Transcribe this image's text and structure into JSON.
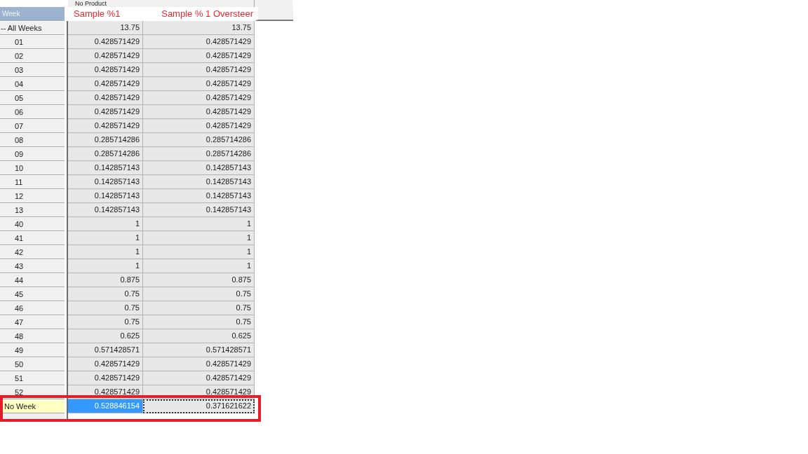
{
  "grid": {
    "product_header": "No Product",
    "row_header_title": "Week",
    "columns": [
      {
        "label": "Sample %1"
      },
      {
        "label": "Sample % 1 Oversteer"
      }
    ],
    "rows": [
      {
        "label": "-- All Weeks",
        "kind": "total",
        "selected": false,
        "outlined": false,
        "cells": [
          {
            "value": "13.75",
            "selected": false,
            "focused": false
          },
          {
            "value": "13.75",
            "selected": false,
            "focused": false
          }
        ]
      },
      {
        "label": "01",
        "kind": "week",
        "selected": false,
        "outlined": false,
        "cells": [
          {
            "value": "0.428571429",
            "selected": false,
            "focused": false
          },
          {
            "value": "0.428571429",
            "selected": false,
            "focused": false
          }
        ]
      },
      {
        "label": "02",
        "kind": "week",
        "selected": false,
        "outlined": false,
        "cells": [
          {
            "value": "0.428571429",
            "selected": false,
            "focused": false
          },
          {
            "value": "0.428571429",
            "selected": false,
            "focused": false
          }
        ]
      },
      {
        "label": "03",
        "kind": "week",
        "selected": false,
        "outlined": false,
        "cells": [
          {
            "value": "0.428571429",
            "selected": false,
            "focused": false
          },
          {
            "value": "0.428571429",
            "selected": false,
            "focused": false
          }
        ]
      },
      {
        "label": "04",
        "kind": "week",
        "selected": false,
        "outlined": false,
        "cells": [
          {
            "value": "0.428571429",
            "selected": false,
            "focused": false
          },
          {
            "value": "0.428571429",
            "selected": false,
            "focused": false
          }
        ]
      },
      {
        "label": "05",
        "kind": "week",
        "selected": false,
        "outlined": false,
        "cells": [
          {
            "value": "0.428571429",
            "selected": false,
            "focused": false
          },
          {
            "value": "0.428571429",
            "selected": false,
            "focused": false
          }
        ]
      },
      {
        "label": "06",
        "kind": "week",
        "selected": false,
        "outlined": false,
        "cells": [
          {
            "value": "0.428571429",
            "selected": false,
            "focused": false
          },
          {
            "value": "0.428571429",
            "selected": false,
            "focused": false
          }
        ]
      },
      {
        "label": "07",
        "kind": "week",
        "selected": false,
        "outlined": false,
        "cells": [
          {
            "value": "0.428571429",
            "selected": false,
            "focused": false
          },
          {
            "value": "0.428571429",
            "selected": false,
            "focused": false
          }
        ]
      },
      {
        "label": "08",
        "kind": "week",
        "selected": false,
        "outlined": false,
        "cells": [
          {
            "value": "0.285714286",
            "selected": false,
            "focused": false
          },
          {
            "value": "0.285714286",
            "selected": false,
            "focused": false
          }
        ]
      },
      {
        "label": "09",
        "kind": "week",
        "selected": false,
        "outlined": false,
        "cells": [
          {
            "value": "0.285714286",
            "selected": false,
            "focused": false
          },
          {
            "value": "0.285714286",
            "selected": false,
            "focused": false
          }
        ]
      },
      {
        "label": "10",
        "kind": "week",
        "selected": false,
        "outlined": false,
        "cells": [
          {
            "value": "0.142857143",
            "selected": false,
            "focused": false
          },
          {
            "value": "0.142857143",
            "selected": false,
            "focused": false
          }
        ]
      },
      {
        "label": "11",
        "kind": "week",
        "selected": false,
        "outlined": false,
        "cells": [
          {
            "value": "0.142857143",
            "selected": false,
            "focused": false
          },
          {
            "value": "0.142857143",
            "selected": false,
            "focused": false
          }
        ]
      },
      {
        "label": "12",
        "kind": "week",
        "selected": false,
        "outlined": false,
        "cells": [
          {
            "value": "0.142857143",
            "selected": false,
            "focused": false
          },
          {
            "value": "0.142857143",
            "selected": false,
            "focused": false
          }
        ]
      },
      {
        "label": "13",
        "kind": "week",
        "selected": false,
        "outlined": false,
        "cells": [
          {
            "value": "0.142857143",
            "selected": false,
            "focused": false
          },
          {
            "value": "0.142857143",
            "selected": false,
            "focused": false
          }
        ]
      },
      {
        "label": "40",
        "kind": "week",
        "selected": false,
        "outlined": false,
        "cells": [
          {
            "value": "1",
            "selected": false,
            "focused": false
          },
          {
            "value": "1",
            "selected": false,
            "focused": false
          }
        ]
      },
      {
        "label": "41",
        "kind": "week",
        "selected": false,
        "outlined": false,
        "cells": [
          {
            "value": "1",
            "selected": false,
            "focused": false
          },
          {
            "value": "1",
            "selected": false,
            "focused": false
          }
        ]
      },
      {
        "label": "42",
        "kind": "week",
        "selected": false,
        "outlined": false,
        "cells": [
          {
            "value": "1",
            "selected": false,
            "focused": false
          },
          {
            "value": "1",
            "selected": false,
            "focused": false
          }
        ]
      },
      {
        "label": "43",
        "kind": "week",
        "selected": false,
        "outlined": false,
        "cells": [
          {
            "value": "1",
            "selected": false,
            "focused": false
          },
          {
            "value": "1",
            "selected": false,
            "focused": false
          }
        ]
      },
      {
        "label": "44",
        "kind": "week",
        "selected": false,
        "outlined": false,
        "cells": [
          {
            "value": "0.875",
            "selected": false,
            "focused": false
          },
          {
            "value": "0.875",
            "selected": false,
            "focused": false
          }
        ]
      },
      {
        "label": "45",
        "kind": "week",
        "selected": false,
        "outlined": false,
        "cells": [
          {
            "value": "0.75",
            "selected": false,
            "focused": false
          },
          {
            "value": "0.75",
            "selected": false,
            "focused": false
          }
        ]
      },
      {
        "label": "46",
        "kind": "week",
        "selected": false,
        "outlined": false,
        "cells": [
          {
            "value": "0.75",
            "selected": false,
            "focused": false
          },
          {
            "value": "0.75",
            "selected": false,
            "focused": false
          }
        ]
      },
      {
        "label": "47",
        "kind": "week",
        "selected": false,
        "outlined": false,
        "cells": [
          {
            "value": "0.75",
            "selected": false,
            "focused": false
          },
          {
            "value": "0.75",
            "selected": false,
            "focused": false
          }
        ]
      },
      {
        "label": "48",
        "kind": "week",
        "selected": false,
        "outlined": false,
        "cells": [
          {
            "value": "0.625",
            "selected": false,
            "focused": false
          },
          {
            "value": "0.625",
            "selected": false,
            "focused": false
          }
        ]
      },
      {
        "label": "49",
        "kind": "week",
        "selected": false,
        "outlined": false,
        "cells": [
          {
            "value": "0.571428571",
            "selected": false,
            "focused": false
          },
          {
            "value": "0.571428571",
            "selected": false,
            "focused": false
          }
        ]
      },
      {
        "label": "50",
        "kind": "week",
        "selected": false,
        "outlined": false,
        "cells": [
          {
            "value": "0.428571429",
            "selected": false,
            "focused": false
          },
          {
            "value": "0.428571429",
            "selected": false,
            "focused": false
          }
        ]
      },
      {
        "label": "51",
        "kind": "week",
        "selected": false,
        "outlined": false,
        "cells": [
          {
            "value": "0.428571429",
            "selected": false,
            "focused": false
          },
          {
            "value": "0.428571429",
            "selected": false,
            "focused": false
          }
        ]
      },
      {
        "label": "52",
        "kind": "week",
        "selected": false,
        "outlined": false,
        "cells": [
          {
            "value": "0.428571429",
            "selected": false,
            "focused": false
          },
          {
            "value": "0.428571429",
            "selected": false,
            "focused": false
          }
        ]
      },
      {
        "label": "No Week",
        "kind": "none",
        "selected": true,
        "outlined": true,
        "cells": [
          {
            "value": "0.528846154",
            "selected": true,
            "focused": false
          },
          {
            "value": "0.371621622",
            "selected": false,
            "focused": true
          }
        ]
      }
    ]
  }
}
